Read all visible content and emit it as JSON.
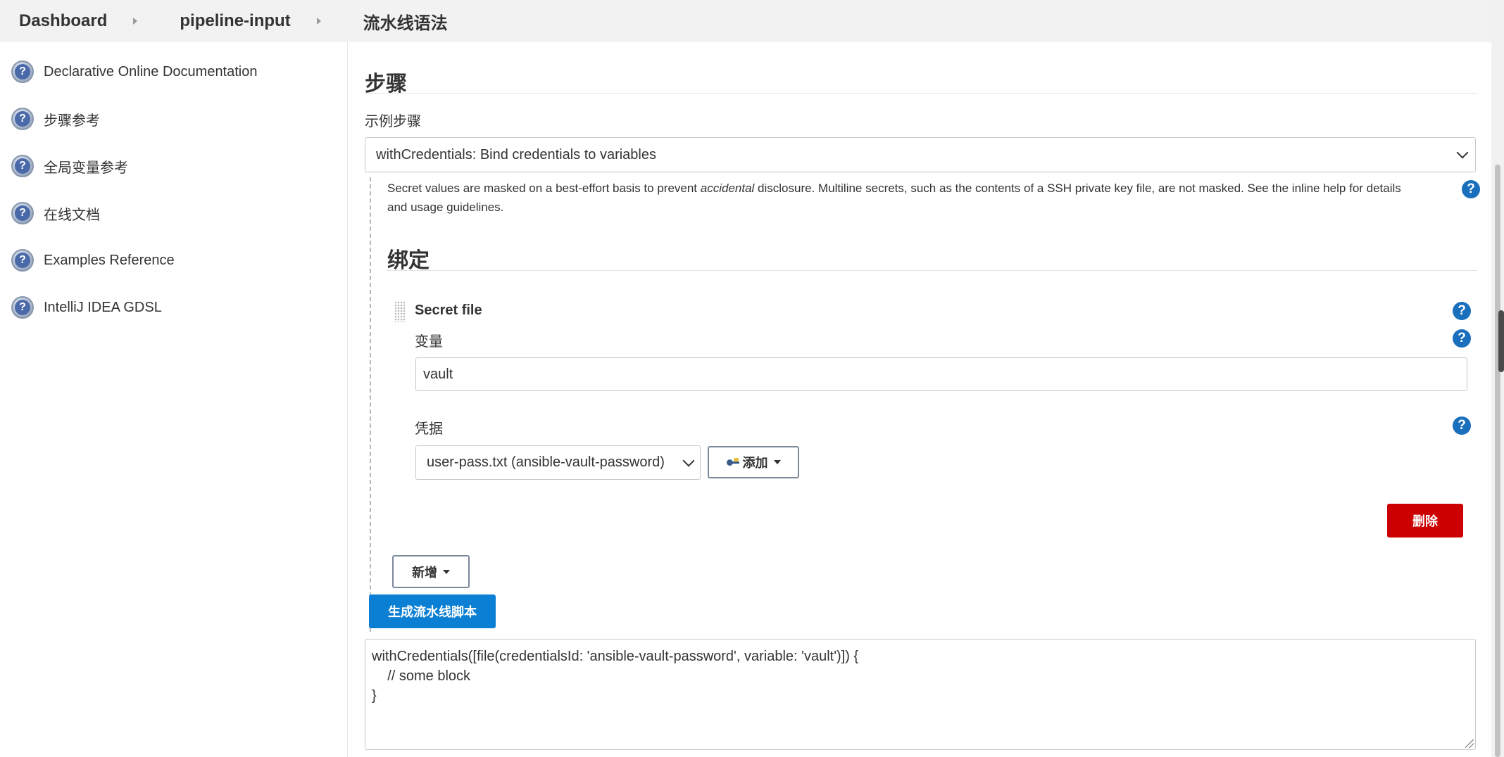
{
  "breadcrumb": {
    "items": [
      "Dashboard",
      "pipeline-input",
      "流水线语法"
    ]
  },
  "sidebar": {
    "items": [
      {
        "label": "Declarative Online Documentation"
      },
      {
        "label": "步骤参考"
      },
      {
        "label": "全局变量参考"
      },
      {
        "label": "在线文档"
      },
      {
        "label": "Examples Reference"
      },
      {
        "label": "IntelliJ IDEA GDSL"
      }
    ]
  },
  "main": {
    "steps_heading": "步骤",
    "sample_step_label": "示例步骤",
    "sample_step_value": "withCredentials: Bind credentials to variables",
    "notice_before": "Secret values are masked on a best-effort basis to prevent ",
    "notice_em": "accidental",
    "notice_after": " disclosure. Multiline secrets, such as the contents of a SSH private key file, are not masked. See the inline help for details and usage guidelines.",
    "bindings_heading": "绑定",
    "binding": {
      "type_title": "Secret file",
      "variable_label": "变量",
      "variable_value": "vault",
      "credentials_label": "凭据",
      "credentials_value": "user-pass.txt (ansible-vault-password)",
      "add_button_label": "添加",
      "delete_button_label": "删除"
    },
    "new_button_label": "新增",
    "generate_button_label": "生成流水线脚本",
    "generated_script": "withCredentials([file(credentialsId: 'ansible-vault-password', variable: 'vault')]) {\n    // some block\n}",
    "help_icon_glyph": "?"
  },
  "colors": {
    "help_blue": "#1a6fbd",
    "delete_red": "#cc0000",
    "generate_blue": "#0b7fd4"
  }
}
